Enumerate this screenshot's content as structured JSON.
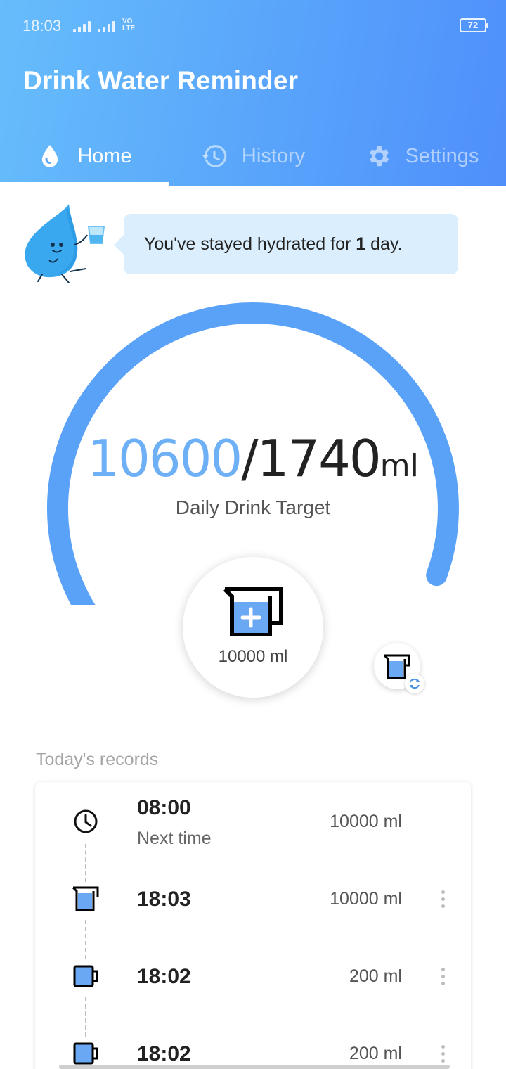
{
  "status_bar": {
    "time": "18:03",
    "network": "VO LTE",
    "battery": "72"
  },
  "app": {
    "title": "Drink Water Reminder"
  },
  "tabs": [
    {
      "label": "Home",
      "icon": "water-drop-icon",
      "active": true
    },
    {
      "label": "History",
      "icon": "history-icon",
      "active": false
    },
    {
      "label": "Settings",
      "icon": "gear-icon",
      "active": false
    }
  ],
  "message": {
    "prefix": "You've stayed hydrated for ",
    "days": "1",
    "suffix": " day."
  },
  "progress": {
    "current": "10600",
    "separator": "/",
    "target": "1740",
    "unit": "ml",
    "label": "Daily Drink Target",
    "fraction": 1.0
  },
  "add_button": {
    "amount_label": "10000 ml",
    "icon": "cup-plus-icon"
  },
  "switch_cup": {
    "icon": "cup-switch-icon"
  },
  "records": {
    "title": "Today's records",
    "items": [
      {
        "time": "08:00",
        "sub": "Next time",
        "volume": "10000 ml",
        "icon": "clock-icon"
      },
      {
        "time": "18:03",
        "sub": "",
        "volume": "10000 ml",
        "icon": "cup-icon"
      },
      {
        "time": "18:02",
        "sub": "",
        "volume": "200 ml",
        "icon": "mug-icon"
      },
      {
        "time": "18:02",
        "sub": "",
        "volume": "200 ml",
        "icon": "mug-icon"
      }
    ]
  },
  "colors": {
    "primary": "#5aa6fb",
    "gauge": "#5aa2f7",
    "accent_text": "#6db0f6"
  }
}
